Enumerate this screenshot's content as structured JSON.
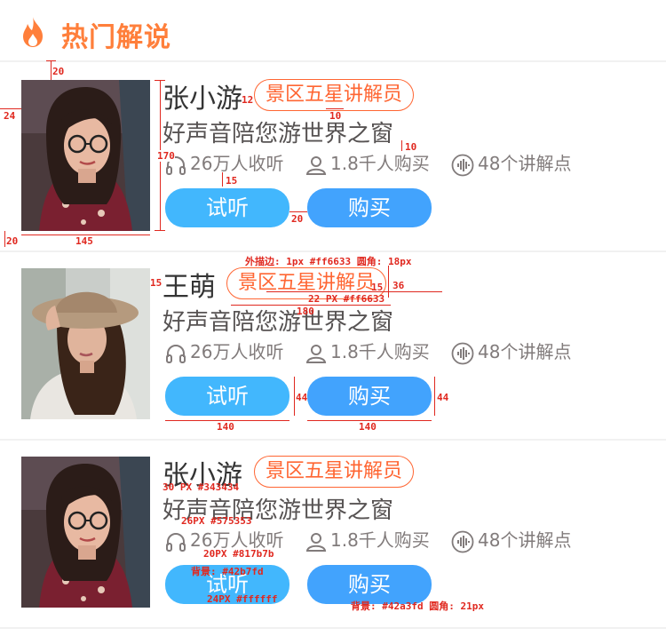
{
  "header": {
    "title": "热门解说",
    "icon": "fire-icon"
  },
  "cards": [
    {
      "name": "张小游",
      "tag": "景区五星讲解员",
      "desc": "好声音陪您游世界之窗",
      "listeners": "26万人收听",
      "buyers": "1.8千人购买",
      "points": "48个讲解点",
      "listen_label": "试听",
      "buy_label": "购买"
    },
    {
      "name": "王萌",
      "tag": "景区五星讲解员",
      "desc": "好声音陪您游世界之窗",
      "listeners": "26万人收听",
      "buyers": "1.8千人购买",
      "points": "48个讲解点",
      "listen_label": "试听",
      "buy_label": "购买"
    },
    {
      "name": "张小游",
      "tag": "景区五星讲解员",
      "desc": "好声音陪您游世界之窗",
      "listeners": "26万人收听",
      "buyers": "1.8千人购买",
      "points": "48个讲解点",
      "listen_label": "试听",
      "buy_label": "购买"
    }
  ],
  "colors": {
    "accent": "#ff7f3b",
    "tag_border": "#ff6633",
    "name": "#343434",
    "desc": "#575353",
    "meta": "#817b7b",
    "listen_bg": "#42b7fd",
    "buy_bg": "#42a3fd",
    "annotation": "#e0281f"
  },
  "annotations": {
    "a1": "20",
    "a2": "24",
    "a3": "12",
    "a4": "10",
    "a5": "170",
    "a6": "10",
    "a7": "15",
    "a8": "20",
    "a9": "20",
    "a10": "145",
    "b1": "外描边: 1px  #ff6633   圆角: 18px",
    "b2": "15",
    "b3": "15",
    "b4": "36",
    "b5": "22 PX  #ff6633",
    "b6": "180",
    "b7": "44",
    "b8": "44",
    "b9": "140",
    "b10": "140",
    "c1": "30 PX  #343434",
    "c2": "26PX  #575353",
    "c3": "20PX  #817b7b",
    "c4": "背景: #42b7fd",
    "c5": "24PX  #ffffff",
    "c6": "背景: #42a3fd   圆角: 21px"
  }
}
